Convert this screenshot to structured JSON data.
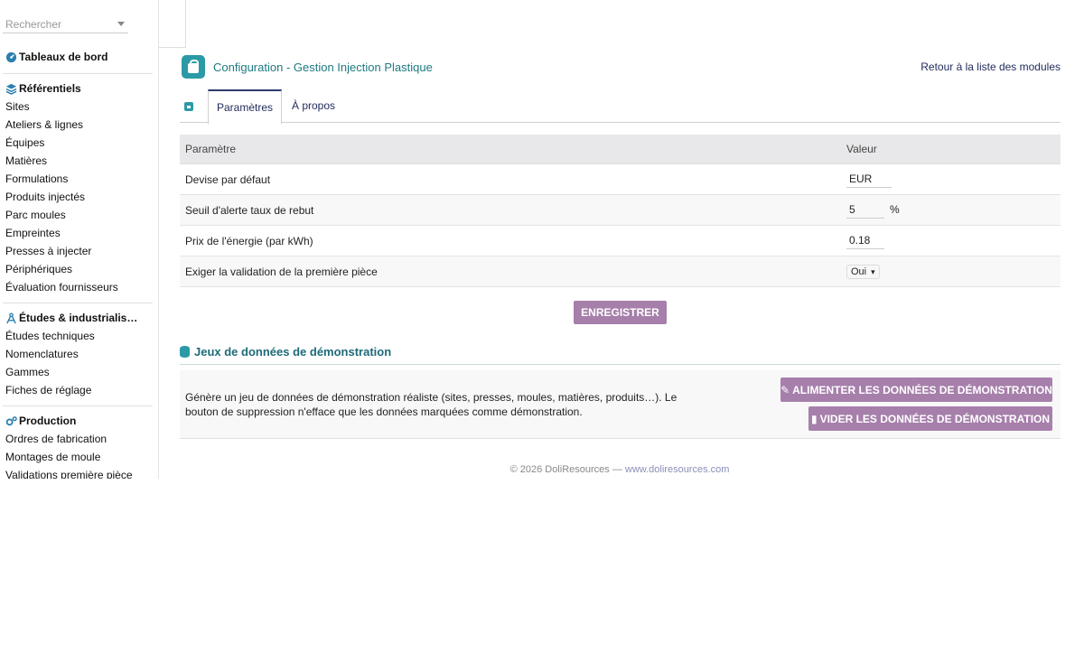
{
  "search": {
    "placeholder": "Rechercher"
  },
  "sidebar": {
    "dashboard": "Tableaux de bord",
    "referentiels": {
      "title": "Référentiels",
      "items": [
        "Sites",
        "Ateliers & lignes",
        "Équipes",
        "Matières",
        "Formulations",
        "Produits injectés",
        "Parc moules",
        "Empreintes",
        "Presses à injecter",
        "Périphériques",
        "Évaluation fournisseurs"
      ]
    },
    "etudes": {
      "title": "Études & industrialis…",
      "items": [
        "Études techniques",
        "Nomenclatures",
        "Gammes",
        "Fiches de réglage"
      ]
    },
    "production": {
      "title": "Production",
      "items": [
        "Ordres de fabrication",
        "Montages de moule",
        "Validations première pièce"
      ]
    }
  },
  "header": {
    "title": "Configuration - Gestion Injection Plastique",
    "back_link": "Retour à la liste des modules"
  },
  "tabs": [
    {
      "label": "Paramètres",
      "active": true
    },
    {
      "label": "À propos",
      "active": false
    }
  ],
  "params_table": {
    "headers": [
      "Paramètre",
      "Valeur"
    ],
    "rows": [
      {
        "label": "Devise par défaut",
        "value": "EUR",
        "suffix": ""
      },
      {
        "label": "Seuil d'alerte taux de rebut",
        "value": "5",
        "suffix": "%"
      },
      {
        "label": "Prix de l'énergie (par kWh)",
        "value": "0.18",
        "suffix": ""
      },
      {
        "label": "Exiger la validation de la première pièce",
        "value": "Oui",
        "suffix": ""
      }
    ]
  },
  "save_label": "ENREGISTRER",
  "demo": {
    "title": "Jeux de données de démonstration",
    "text": "Génère un jeu de données de démonstration réaliste (sites, presses, moules, matières, produits…). Le bouton de suppression n'efface que les données marquées comme démonstration.",
    "feed_label": "ALIMENTER LES DONNÉES DE DÉMONSTRATION",
    "clear_label": "VIDER LES DONNÉES DE DÉMONSTRATION"
  },
  "footer": {
    "copyright": "© 2026 DoliResources — ",
    "link": "www.doliresources.com"
  },
  "colors": {
    "accent": "#2c9aa6",
    "button": "#a67fab",
    "title": "#1e7a82"
  }
}
